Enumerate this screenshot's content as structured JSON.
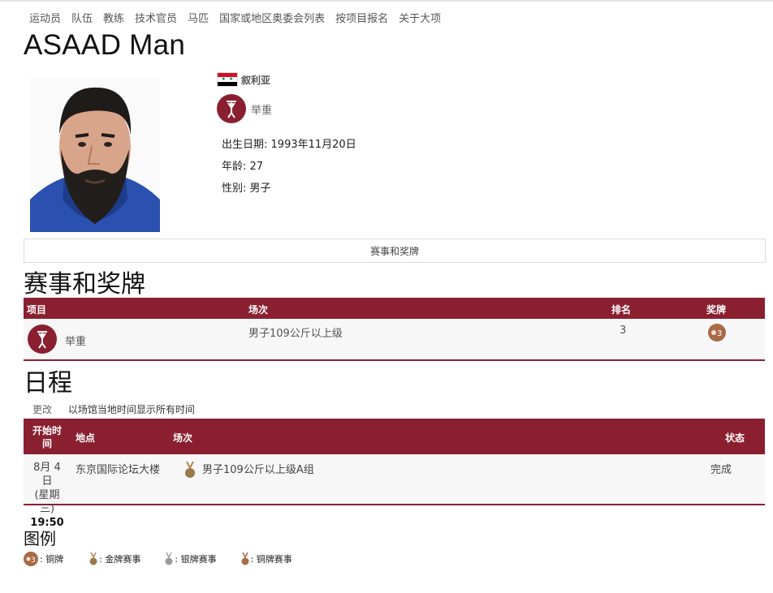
{
  "nav": [
    "运动员",
    "队伍",
    "教练",
    "技术官员",
    "马匹",
    "国家或地区奥委会列表",
    "按项目报名",
    "关于大项"
  ],
  "athlete": {
    "name": "ASAAD Man",
    "country": "叙利亚",
    "sport": "举重",
    "dob_label": "出生日期:",
    "dob": "1993年11月20日",
    "age_label": "年龄:",
    "age": "27",
    "gender_label": "性别:",
    "gender": "男子"
  },
  "tab": "赛事和奖牌",
  "events_section": {
    "title": "赛事和奖牌",
    "headers": [
      "项目",
      "场次",
      "排名",
      "奖牌"
    ],
    "rows": [
      {
        "sport": "举重",
        "event": "男子109公斤以上级",
        "rank": "3",
        "medal": "铜牌"
      }
    ]
  },
  "schedule_section": {
    "title": "日程",
    "change": "更改",
    "note": "以场馆当地时间显示所有时间",
    "headers": [
      "开始时间",
      "地点",
      "场次",
      "状态"
    ],
    "rows": [
      {
        "date": "8月 4日",
        "weekday": "(星期三)",
        "time": "19:50",
        "venue": "东京国际论坛大楼",
        "event": "男子109公斤以上级A组",
        "status": "完成"
      }
    ]
  },
  "legend": {
    "title": "图例",
    "items": [
      ": 铜牌",
      ": 金牌赛事",
      ": 银牌赛事",
      ": 铜牌赛事"
    ]
  },
  "colors": {
    "accent": "#8a1f30",
    "bronze": "#a86a46",
    "gold": "#b0894f",
    "silver": "#a0a0a0"
  }
}
